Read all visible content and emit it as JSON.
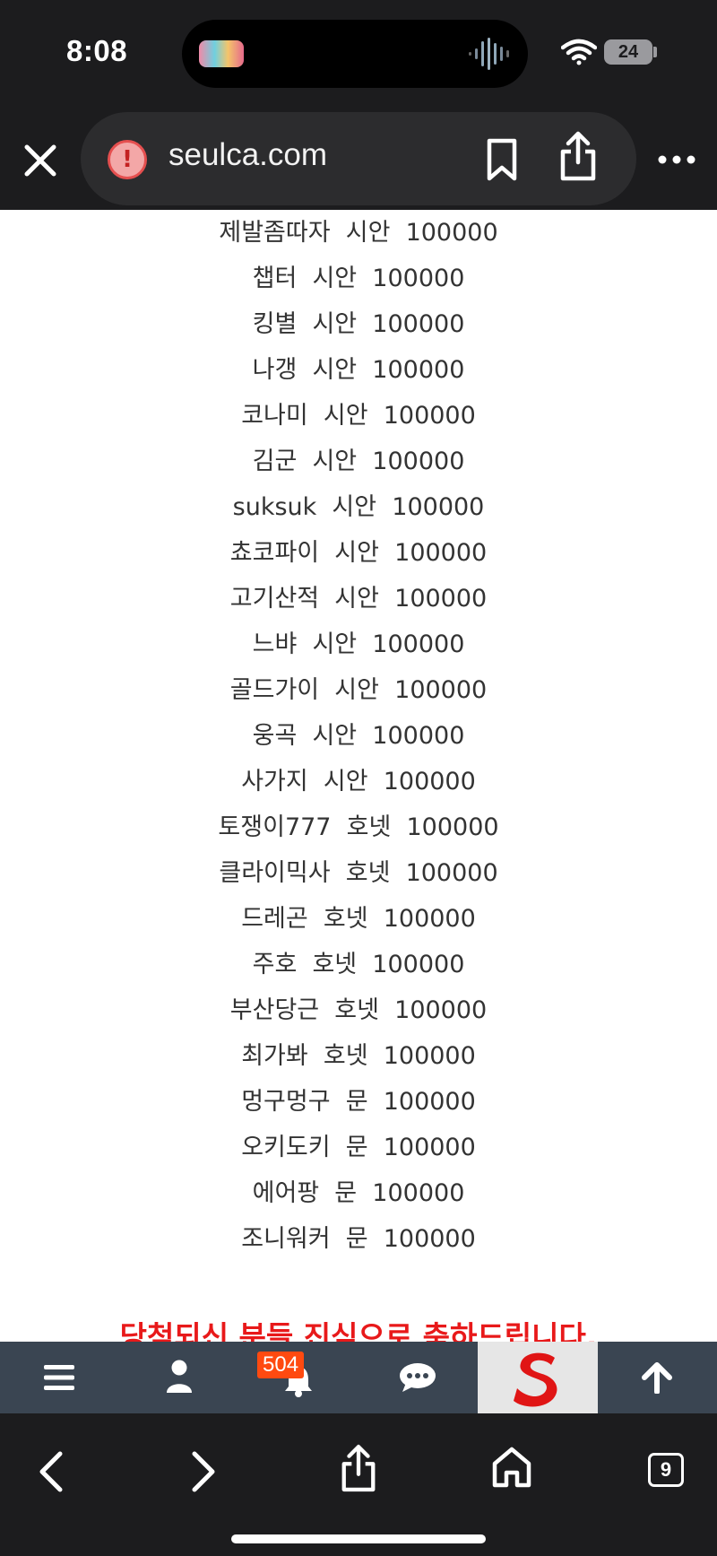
{
  "status_bar": {
    "time": "8:08",
    "battery": "24"
  },
  "browser": {
    "url": "seulca.com",
    "tab_count": "9"
  },
  "winners": [
    "제발좀따자  시안  100000",
    "챕터  시안  100000",
    "킹별  시안  100000",
    "나갱  시안  100000",
    "코나미  시안  100000",
    "김군  시안  100000",
    "suksuk  시안  100000",
    "쵸코파이  시안  100000",
    "고기산적  시안  100000",
    "느뱌  시안  100000",
    "골드가이  시안  100000",
    "웅곡  시안  100000",
    "사가지  시안  100000",
    "토쟁이777  호넷  100000",
    "클라이믹사  호넷  100000",
    "드레곤  호넷  100000",
    "주호  호넷  100000",
    "부산당근  호넷  100000",
    "최가봐  호넷  100000",
    "멍구멍구  문  100000",
    "오키도키  문  100000",
    "에어팡  문  100000",
    "조니워커  문  100000"
  ],
  "congrats_text": "당첨되신 분들 진심으로 축하드립니다.",
  "site_nav": {
    "notification_count": "504"
  },
  "colors": {
    "accent_red": "#e8191a",
    "nav_bg": "#3a4552",
    "badge": "#ff4a10"
  }
}
